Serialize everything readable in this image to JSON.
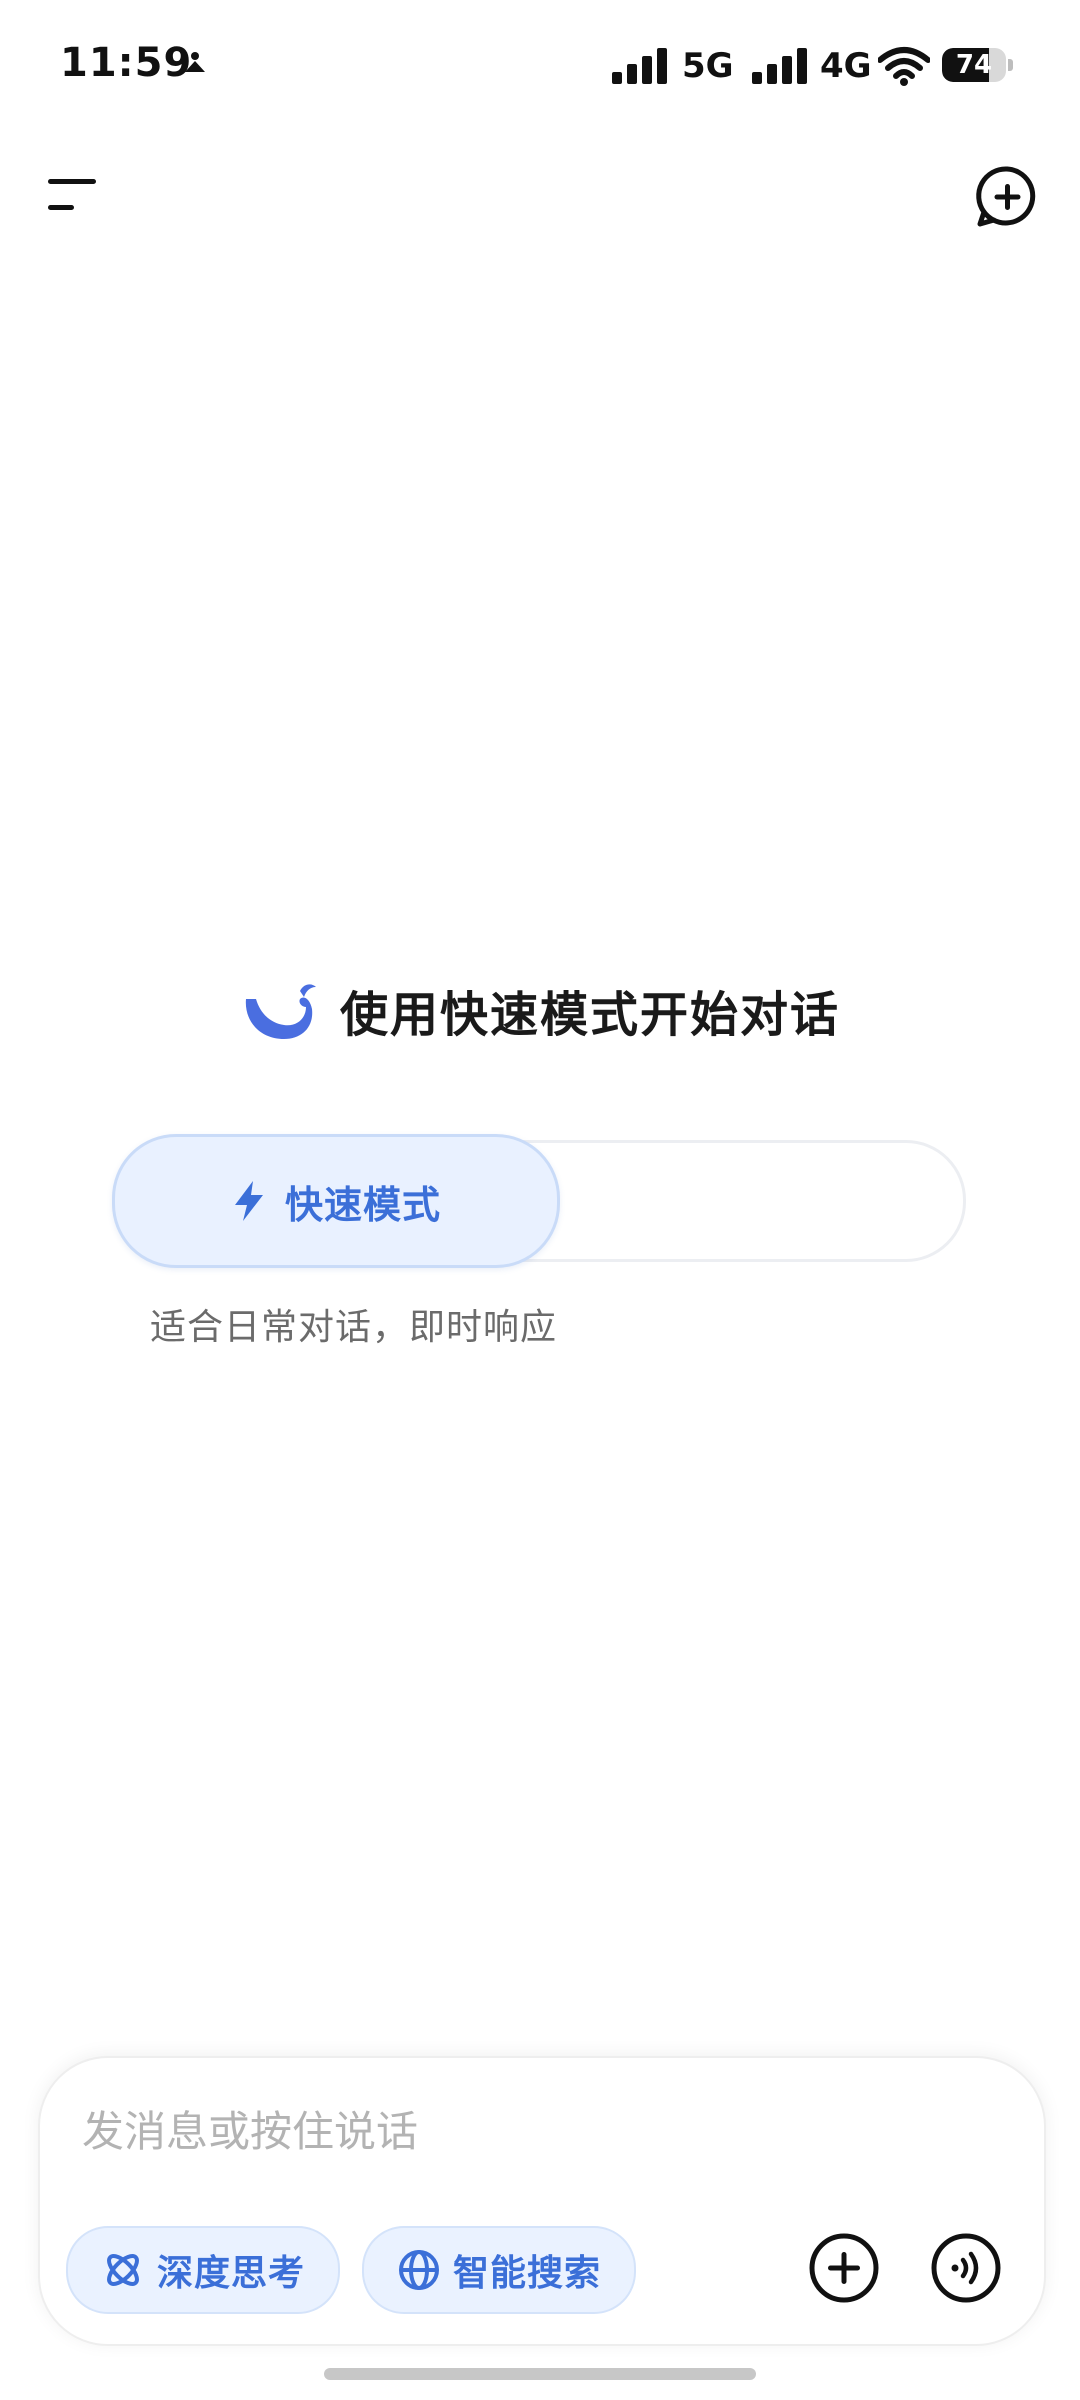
{
  "status_bar": {
    "time": "11:59",
    "network_1": "5G",
    "network_2": "4G",
    "battery": "74",
    "icons": [
      "location-icon",
      "signal-icon",
      "wifi-icon",
      "battery-icon"
    ]
  },
  "nav": {
    "icons": [
      "menu-icon",
      "new-chat-icon"
    ]
  },
  "hero": {
    "logo_icon": "whale-logo-icon",
    "title": "使用快速模式开始对话"
  },
  "mode": {
    "active_label": "快速模式",
    "active_icon": "lightning-icon",
    "description": "适合日常对话，即时响应"
  },
  "composer": {
    "placeholder": "发消息或按住说话",
    "deep_think_label": "深度思考",
    "deep_think_icon": "atom-icon",
    "web_search_label": "智能搜索",
    "web_search_icon": "globe-icon",
    "add_icon": "plus-circle-icon",
    "voice_icon": "voice-call-icon"
  },
  "colors": {
    "accent": "#3b6fd8",
    "accent_bg": "#e9f1ff",
    "text": "#1a1a1a",
    "muted": "#6b6b6b",
    "placeholder": "#b3b3b3"
  }
}
